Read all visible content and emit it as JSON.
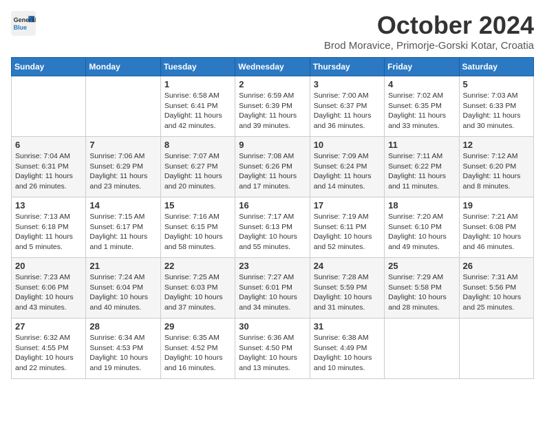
{
  "header": {
    "logo_line1": "General",
    "logo_line2": "Blue",
    "month_title": "October 2024",
    "location": "Brod Moravice, Primorje-Gorski Kotar, Croatia"
  },
  "weekdays": [
    "Sunday",
    "Monday",
    "Tuesday",
    "Wednesday",
    "Thursday",
    "Friday",
    "Saturday"
  ],
  "weeks": [
    [
      {
        "day": "",
        "info": ""
      },
      {
        "day": "",
        "info": ""
      },
      {
        "day": "1",
        "info": "Sunrise: 6:58 AM\nSunset: 6:41 PM\nDaylight: 11 hours and 42 minutes."
      },
      {
        "day": "2",
        "info": "Sunrise: 6:59 AM\nSunset: 6:39 PM\nDaylight: 11 hours and 39 minutes."
      },
      {
        "day": "3",
        "info": "Sunrise: 7:00 AM\nSunset: 6:37 PM\nDaylight: 11 hours and 36 minutes."
      },
      {
        "day": "4",
        "info": "Sunrise: 7:02 AM\nSunset: 6:35 PM\nDaylight: 11 hours and 33 minutes."
      },
      {
        "day": "5",
        "info": "Sunrise: 7:03 AM\nSunset: 6:33 PM\nDaylight: 11 hours and 30 minutes."
      }
    ],
    [
      {
        "day": "6",
        "info": "Sunrise: 7:04 AM\nSunset: 6:31 PM\nDaylight: 11 hours and 26 minutes."
      },
      {
        "day": "7",
        "info": "Sunrise: 7:06 AM\nSunset: 6:29 PM\nDaylight: 11 hours and 23 minutes."
      },
      {
        "day": "8",
        "info": "Sunrise: 7:07 AM\nSunset: 6:27 PM\nDaylight: 11 hours and 20 minutes."
      },
      {
        "day": "9",
        "info": "Sunrise: 7:08 AM\nSunset: 6:26 PM\nDaylight: 11 hours and 17 minutes."
      },
      {
        "day": "10",
        "info": "Sunrise: 7:09 AM\nSunset: 6:24 PM\nDaylight: 11 hours and 14 minutes."
      },
      {
        "day": "11",
        "info": "Sunrise: 7:11 AM\nSunset: 6:22 PM\nDaylight: 11 hours and 11 minutes."
      },
      {
        "day": "12",
        "info": "Sunrise: 7:12 AM\nSunset: 6:20 PM\nDaylight: 11 hours and 8 minutes."
      }
    ],
    [
      {
        "day": "13",
        "info": "Sunrise: 7:13 AM\nSunset: 6:18 PM\nDaylight: 11 hours and 5 minutes."
      },
      {
        "day": "14",
        "info": "Sunrise: 7:15 AM\nSunset: 6:17 PM\nDaylight: 11 hours and 1 minute."
      },
      {
        "day": "15",
        "info": "Sunrise: 7:16 AM\nSunset: 6:15 PM\nDaylight: 10 hours and 58 minutes."
      },
      {
        "day": "16",
        "info": "Sunrise: 7:17 AM\nSunset: 6:13 PM\nDaylight: 10 hours and 55 minutes."
      },
      {
        "day": "17",
        "info": "Sunrise: 7:19 AM\nSunset: 6:11 PM\nDaylight: 10 hours and 52 minutes."
      },
      {
        "day": "18",
        "info": "Sunrise: 7:20 AM\nSunset: 6:10 PM\nDaylight: 10 hours and 49 minutes."
      },
      {
        "day": "19",
        "info": "Sunrise: 7:21 AM\nSunset: 6:08 PM\nDaylight: 10 hours and 46 minutes."
      }
    ],
    [
      {
        "day": "20",
        "info": "Sunrise: 7:23 AM\nSunset: 6:06 PM\nDaylight: 10 hours and 43 minutes."
      },
      {
        "day": "21",
        "info": "Sunrise: 7:24 AM\nSunset: 6:04 PM\nDaylight: 10 hours and 40 minutes."
      },
      {
        "day": "22",
        "info": "Sunrise: 7:25 AM\nSunset: 6:03 PM\nDaylight: 10 hours and 37 minutes."
      },
      {
        "day": "23",
        "info": "Sunrise: 7:27 AM\nSunset: 6:01 PM\nDaylight: 10 hours and 34 minutes."
      },
      {
        "day": "24",
        "info": "Sunrise: 7:28 AM\nSunset: 5:59 PM\nDaylight: 10 hours and 31 minutes."
      },
      {
        "day": "25",
        "info": "Sunrise: 7:29 AM\nSunset: 5:58 PM\nDaylight: 10 hours and 28 minutes."
      },
      {
        "day": "26",
        "info": "Sunrise: 7:31 AM\nSunset: 5:56 PM\nDaylight: 10 hours and 25 minutes."
      }
    ],
    [
      {
        "day": "27",
        "info": "Sunrise: 6:32 AM\nSunset: 4:55 PM\nDaylight: 10 hours and 22 minutes."
      },
      {
        "day": "28",
        "info": "Sunrise: 6:34 AM\nSunset: 4:53 PM\nDaylight: 10 hours and 19 minutes."
      },
      {
        "day": "29",
        "info": "Sunrise: 6:35 AM\nSunset: 4:52 PM\nDaylight: 10 hours and 16 minutes."
      },
      {
        "day": "30",
        "info": "Sunrise: 6:36 AM\nSunset: 4:50 PM\nDaylight: 10 hours and 13 minutes."
      },
      {
        "day": "31",
        "info": "Sunrise: 6:38 AM\nSunset: 4:49 PM\nDaylight: 10 hours and 10 minutes."
      },
      {
        "day": "",
        "info": ""
      },
      {
        "day": "",
        "info": ""
      }
    ]
  ]
}
